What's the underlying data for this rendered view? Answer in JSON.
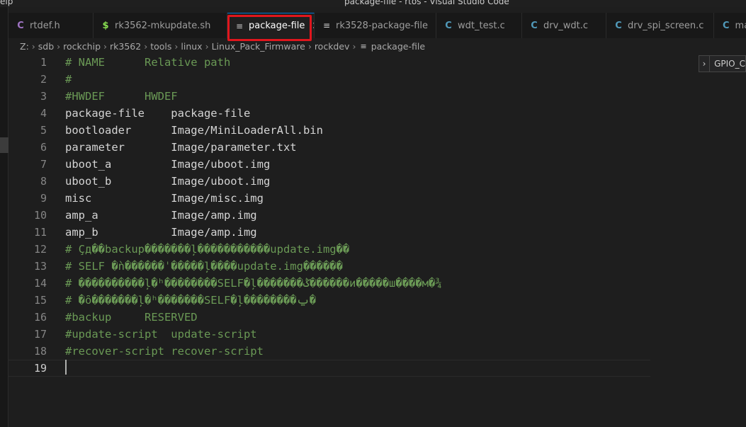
{
  "window": {
    "menu_partial": "elp",
    "title": "package-file - rtos - Visual Studio Code"
  },
  "tabs": [
    {
      "label": "rtdef.h",
      "icon": "C",
      "icon_name": "c-header-file-icon"
    },
    {
      "label": "rk3562-mkupdate.sh",
      "icon": "$",
      "icon_name": "shell-script-icon"
    },
    {
      "label": "package-file",
      "icon": "≡",
      "icon_name": "plain-text-file-icon",
      "active": true,
      "close": "✕"
    },
    {
      "label": "rk3528-package-file",
      "icon": "≡",
      "icon_name": "plain-text-file-icon"
    },
    {
      "label": "wdt_test.c",
      "icon": "C",
      "icon_name": "c-file-icon"
    },
    {
      "label": "drv_wdt.c",
      "icon": "C",
      "icon_name": "c-file-icon"
    },
    {
      "label": "drv_spi_screen.c",
      "icon": "C",
      "icon_name": "c-file-icon"
    },
    {
      "label": "ma",
      "icon": "C",
      "icon_name": "c-file-icon"
    }
  ],
  "breadcrumb": {
    "segments": [
      "Z:",
      "sdb",
      "rockchip",
      "rk3562",
      "tools",
      "linux",
      "Linux_Pack_Firmware",
      "rockdev"
    ],
    "separator": "›",
    "file_icon": "≡",
    "file": "package-file"
  },
  "outline_widget": {
    "chevron": "›",
    "text": "GPIO_C"
  },
  "editor": {
    "current_line": 19,
    "lines": [
      {
        "n": "1",
        "text": "# NAME      Relative path",
        "comment": true
      },
      {
        "n": "2",
        "text": "#",
        "comment": true
      },
      {
        "n": "3",
        "text": "#HWDEF      HWDEF",
        "comment": true
      },
      {
        "n": "4",
        "text": "package-file    package-file",
        "comment": false
      },
      {
        "n": "5",
        "text": "bootloader      Image/MiniLoaderAll.bin",
        "comment": false
      },
      {
        "n": "6",
        "text": "parameter       Image/parameter.txt",
        "comment": false
      },
      {
        "n": "7",
        "text": "uboot_a         Image/uboot.img",
        "comment": false
      },
      {
        "n": "8",
        "text": "uboot_b         Image/uboot.img",
        "comment": false
      },
      {
        "n": "9",
        "text": "misc            Image/misc.img",
        "comment": false
      },
      {
        "n": "10",
        "text": "amp_a           Image/amp.img",
        "comment": false
      },
      {
        "n": "11",
        "text": "amp_b           Image/amp.img",
        "comment": false
      },
      {
        "n": "12",
        "text": "# Çд��backup�������ļ�����������update.img��",
        "comment": true
      },
      {
        "n": "13",
        "text": "# SELF �ǹ������ˈ�����ļ����update.img������",
        "comment": true
      },
      {
        "n": "14",
        "text": "# ����������ļ�ʰ��������SELF�ļ�������ݣ������и�����ш����м�¾",
        "comment": true
      },
      {
        "n": "15",
        "text": "# �ȏ�������ļ�ʰ�������SELF�ļ��������ݐ�",
        "comment": true
      },
      {
        "n": "16",
        "text": "#backup     RESERVED",
        "comment": true
      },
      {
        "n": "17",
        "text": "#update-script  update-script",
        "comment": true
      },
      {
        "n": "18",
        "text": "#recover-script recover-script",
        "comment": true
      },
      {
        "n": "19",
        "text": "",
        "comment": false
      }
    ]
  }
}
